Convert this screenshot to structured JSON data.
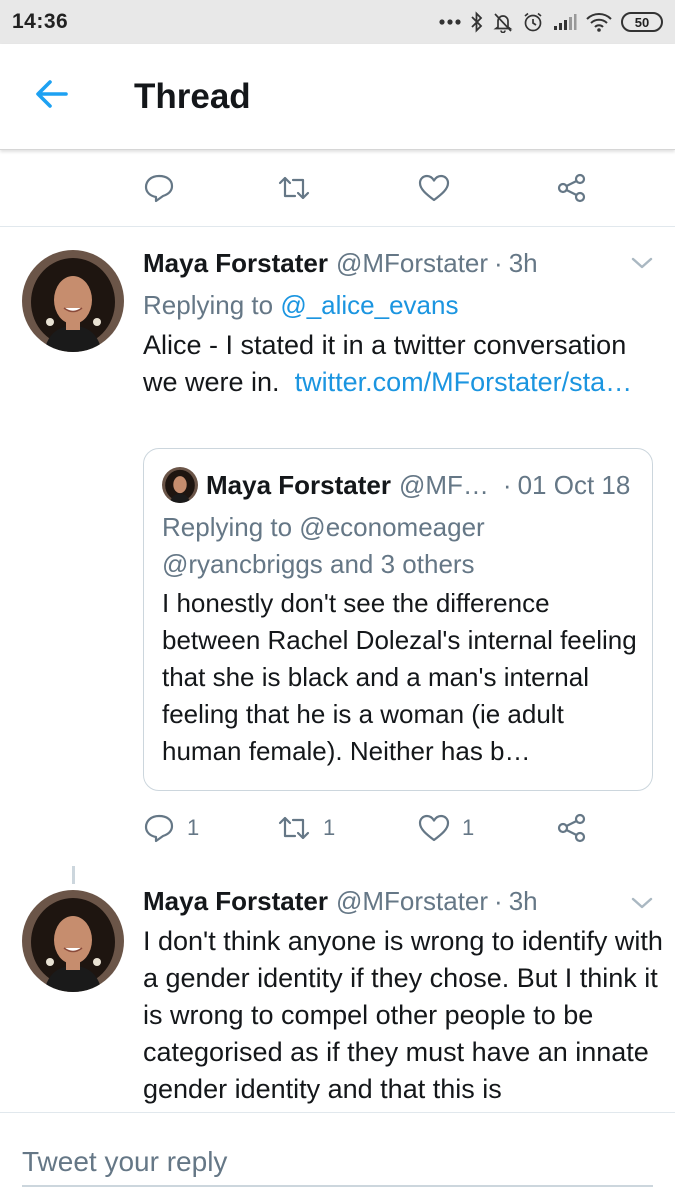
{
  "status_bar": {
    "time": "14:36",
    "battery": "50"
  },
  "header": {
    "title": "Thread"
  },
  "tweets": [
    {
      "name": "Maya Forstater",
      "handle": "@MForstater",
      "time": "3h",
      "replying_prefix": "Replying to ",
      "replying_to": "@_alice_evans",
      "text": "Alice - I stated it in a twitter conversation we were in.",
      "link": "twitter.com/MForstater/sta…",
      "quote": {
        "name": "Maya Forstater",
        "handle": "@MF…",
        "date": "01 Oct 18",
        "replying": "Replying to @economeager @ryancbriggs and 3 others",
        "text": "I honestly don't see the difference between Rachel Dolezal's internal feeling that she is black and a man's internal feeling that he is a woman (ie adult human female). Neither has b…"
      },
      "actions": {
        "replies": "1",
        "retweets": "1",
        "likes": "1"
      }
    },
    {
      "name": "Maya Forstater",
      "handle": "@MForstater",
      "time": "3h",
      "text": "I don't think anyone is wrong to identify with a gender identity if they chose. But I think it is wrong to compel other people to be categorised as if they must have an innate gender identity and that this is"
    }
  ],
  "composer": {
    "placeholder": "Tweet your reply"
  },
  "icons": {
    "back": "arrow-left-icon",
    "reply": "reply-icon",
    "retweet": "retweet-icon",
    "like": "heart-icon",
    "share": "share-icon",
    "caret": "chevron-down-icon"
  },
  "colors": {
    "accent": "#1da1f2",
    "link": "#1b95e0",
    "muted": "#657786"
  }
}
